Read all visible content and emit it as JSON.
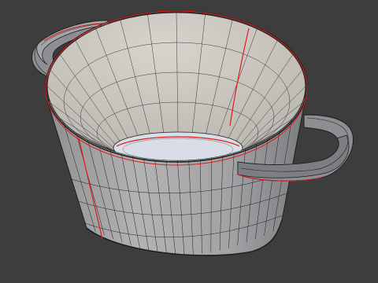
{
  "viewport": {
    "background": "#3d3d3d",
    "mesh": {
      "object": "cooking-pot",
      "surface_outer": "#a9a9ab",
      "surface_inner": "#c6c2bc",
      "surface_bottom": "#d9dde6",
      "wire_color": "#1f1f1f",
      "seam_color": "#e01b1b",
      "handle_fill": "#8d8e92",
      "handle_top": "#a6a7ab"
    }
  }
}
